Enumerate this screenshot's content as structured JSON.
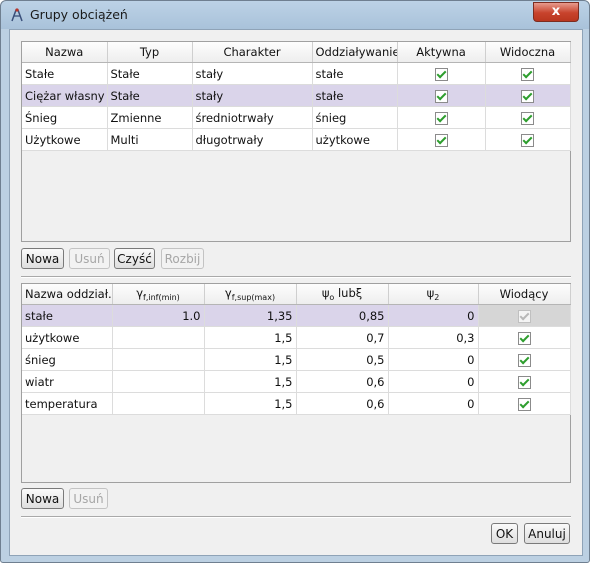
{
  "window": {
    "title": "Grupy obciążeń",
    "close": "x"
  },
  "groups_table": {
    "columns": [
      "Nazwa",
      "Typ",
      "Charakter",
      "Oddziaływanie",
      "Aktywna",
      "Widoczna"
    ],
    "rows": [
      {
        "nazwa": "Stałe",
        "typ": "Stałe",
        "charakter": "stały",
        "oddzialywanie": "stałe",
        "aktywna": true,
        "widoczna": true
      },
      {
        "nazwa": "Ciężar własny",
        "typ": "Stałe",
        "charakter": "stały",
        "oddzialywanie": "stałe",
        "aktywna": true,
        "widoczna": true
      },
      {
        "nazwa": "Śnieg",
        "typ": "Zmienne",
        "charakter": "średniotrwały",
        "oddzialywanie": "śnieg",
        "aktywna": true,
        "widoczna": true
      },
      {
        "nazwa": "Użytkowe",
        "typ": "Multi",
        "charakter": "długotrwały",
        "oddzialywanie": "użytkowe",
        "aktywna": true,
        "widoczna": true
      }
    ],
    "selected_row": 1
  },
  "groups_buttons": {
    "nowa": "Nowa",
    "usun": "Usuń",
    "czysc": "Czyść",
    "rozbij": "Rozbij"
  },
  "factors_table": {
    "columns": {
      "nazwa": "Nazwa oddział...",
      "gmin_symbol": "γ",
      "gmin_sub": "f,inf(min)",
      "gmax_symbol": "γ",
      "gmax_sub": "f,sup(max)",
      "psi0_symbol": "ψ",
      "psi0_sub": "o",
      "psi0_suffix": "lubξ",
      "psi2_symbol": "ψ",
      "psi2_sub": "2",
      "wiodacy": "Wiodący"
    },
    "rows": [
      {
        "nazwa": "stałe",
        "gmin": "1.0",
        "gmax": "1,35",
        "psi0": "0,85",
        "psi2": "0",
        "wiodacy": true,
        "disabled": true
      },
      {
        "nazwa": "użytkowe",
        "gmin": "",
        "gmax": "1,5",
        "psi0": "0,7",
        "psi2": "0,3",
        "wiodacy": true,
        "disabled": false
      },
      {
        "nazwa": "śnieg",
        "gmin": "",
        "gmax": "1,5",
        "psi0": "0,5",
        "psi2": "0",
        "wiodacy": true,
        "disabled": false
      },
      {
        "nazwa": "wiatr",
        "gmin": "",
        "gmax": "1,5",
        "psi0": "0,6",
        "psi2": "0",
        "wiodacy": true,
        "disabled": false
      },
      {
        "nazwa": "temperatura",
        "gmin": "",
        "gmax": "1,5",
        "psi0": "0,6",
        "psi2": "0",
        "wiodacy": true,
        "disabled": false
      }
    ],
    "selected_row": 0
  },
  "factors_buttons": {
    "nowa": "Nowa",
    "usun": "Usuń"
  },
  "dialog_buttons": {
    "ok": "OK",
    "anuluj": "Anuluj"
  }
}
